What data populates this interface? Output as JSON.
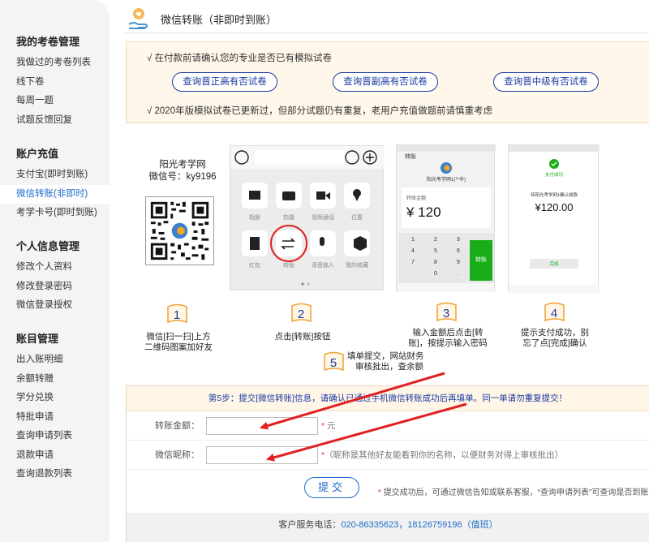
{
  "sidebar": {
    "groups": [
      {
        "title": "我的考卷管理",
        "items": [
          "我做过的考卷列表",
          "线下卷",
          "每周一题",
          "试题反馈回复"
        ]
      },
      {
        "title": "账户充值",
        "items": [
          "支付宝(即时到账)",
          "微信转账(非即时)",
          "考学卡号(即时到账)"
        ]
      },
      {
        "title": "个人信息管理",
        "items": [
          "修改个人资料",
          "修改登录密码",
          "微信登录授权"
        ]
      },
      {
        "title": "账目管理",
        "items": [
          "出入账明细",
          "余额转赠",
          "学分兑换",
          "特批申请",
          "查询申请列表",
          "退款申请",
          "查询退款列表"
        ]
      }
    ]
  },
  "header": {
    "title": "微信转账（非即时到账）"
  },
  "notice": {
    "line1": "√ 在付款前请确认您的专业是否已有模拟试卷",
    "buttons": [
      "查询晋正高有否试卷",
      "查询晋副高有否试卷",
      "查询晋中级有否试卷"
    ],
    "line2": "√ 2020年版模拟试卷已更新过，但部分试题仍有重复，老用户充值做题前请慎重考虑"
  },
  "steps": {
    "qr_label1": "阳光考学网",
    "qr_label2": "微信号：ky9196",
    "items": [
      {
        "num": "1",
        "text1": "微信[扫一扫]上方",
        "text2": "二维码图案加好友"
      },
      {
        "num": "2",
        "text1": "点击[转账]按钮",
        "text2": ""
      },
      {
        "num": "3",
        "text1": "输入金额后点击[转",
        "text2": "账]，按提示输入密码"
      },
      {
        "num": "4",
        "text1": "提示支付成功，别",
        "text2": "忘了点[完成]确认"
      },
      {
        "num": "5",
        "text1": "填单提交，网站财务",
        "text2": "审核批出，查余额"
      }
    ]
  },
  "phone2": {
    "tiles": [
      "相册",
      "拍摄",
      "视频通话",
      "位置",
      "红包",
      "转账",
      "语音输入",
      "我的收藏"
    ]
  },
  "phone3": {
    "title": "转账",
    "payee": "阳光考学网1(**辛)",
    "amount_label": "转账金额",
    "amount": "¥ 120",
    "keys": [
      "1",
      "2",
      "3",
      "4",
      "5",
      "6",
      "7",
      "8",
      "9",
      "0",
      "."
    ],
    "confirm": "转账"
  },
  "phone4": {
    "status": "支付成功",
    "desc": "待阳光考学网1确认收款",
    "amount": "¥120.00",
    "done": "完成"
  },
  "form": {
    "head": "第5步：提交[微信转账]信息，请确认已通过手机微信转账成功后再填单。同一单请勿重复提交！",
    "amount_label": "转账金额：",
    "amount_unit": "元",
    "nick_label": "微信昵称：",
    "nick_hint": "（昵称是其他好友能看到你的名称，以便财务对得上审核批出）",
    "submit": "提交",
    "note": "提交成功后，可通过微信告知或联系客服，“查询申请列表”可查询是否到账",
    "foot_label": "客户服务电话：",
    "foot_phone": "020-86335623，18126759196（值班）"
  },
  "colors": {
    "accent": "#1e6cc8",
    "danger": "#e33333",
    "wechat_green": "#1aad19"
  }
}
